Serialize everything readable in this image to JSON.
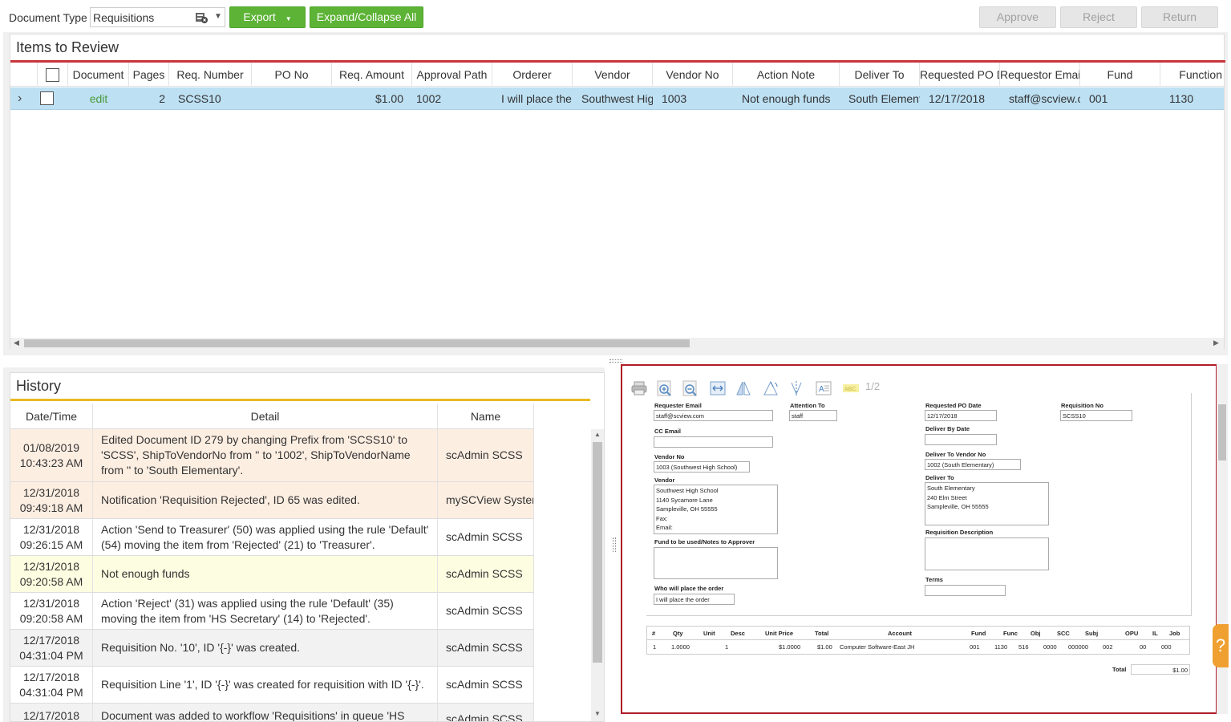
{
  "toolbar": {
    "doc_type_label": "Document Type",
    "doc_type_value": "Requisitions",
    "export_label": "Export",
    "expand_collapse_label": "Expand/Collapse All",
    "approve_label": "Approve",
    "reject_label": "Reject",
    "return_label": "Return"
  },
  "items": {
    "title": "Items to Review",
    "columns": [
      "Document",
      "Pages",
      "Req. Number",
      "PO No",
      "Req. Amount",
      "Approval Path",
      "Orderer",
      "Vendor",
      "Vendor No",
      "Action Note",
      "Deliver To",
      "Requested PO D",
      "Requestor Emai",
      "Fund",
      "Function"
    ],
    "row": {
      "document": "edit",
      "pages": "2",
      "req_number": "SCSS10",
      "po_no": "",
      "req_amount": "$1.00",
      "approval_path": "1002",
      "orderer": "I will place the",
      "vendor": "Southwest Hig",
      "vendor_no": "1003",
      "action_note": "Not enough funds",
      "deliver_to": "South Element",
      "requested_po_date": "12/17/2018",
      "requestor_email": "staff@scview.c",
      "fund": "001",
      "function": "1130"
    }
  },
  "history": {
    "title": "History",
    "columns": [
      "Date/Time",
      "Detail",
      "Name"
    ],
    "rows": [
      {
        "date": "01/08/2019",
        "time": "10:43:23 AM",
        "detail": "Edited Document ID 279 by changing Prefix from 'SCSS10' to 'SCSS', ShipToVendorNo from '' to '1002', ShipToVendorName from '' to 'South Elementary'.",
        "name": "scAdmin SCSS"
      },
      {
        "date": "12/31/2018",
        "time": "09:49:18 AM",
        "detail": "Notification 'Requisition Rejected', ID 65 was edited.",
        "name": "mySCView System"
      },
      {
        "date": "12/31/2018",
        "time": "09:26:15 AM",
        "detail": "Action 'Send to Treasurer' (50) was applied using the rule 'Default' (54) moving the item from 'Rejected' (21) to 'Treasurer'.",
        "name": "scAdmin SCSS"
      },
      {
        "date": "12/31/2018",
        "time": "09:20:58 AM",
        "detail": "Not enough funds",
        "name": "scAdmin SCSS"
      },
      {
        "date": "12/31/2018",
        "time": "09:20:58 AM",
        "detail": "Action 'Reject' (31) was applied using the rule 'Default' (35) moving the item from 'HS Secretary' (14) to 'Rejected'.",
        "name": "scAdmin SCSS"
      },
      {
        "date": "12/17/2018",
        "time": "04:31:04 PM",
        "detail": "Requisition No. '10', ID '{-}' was created.",
        "name": "scAdmin SCSS"
      },
      {
        "date": "12/17/2018",
        "time": "04:31:04 PM",
        "detail": "Requisition Line '1', ID '{-}' was created for requisition with ID '{-}'.",
        "name": "scAdmin SCSS"
      },
      {
        "date": "12/17/2018",
        "time": "",
        "detail": "Document was added to workflow 'Requisitions' in queue 'HS",
        "name": "scAdmin SCSS"
      }
    ]
  },
  "viewer": {
    "page_indicator": "1/2",
    "form": {
      "requester_email_label": "Requester Email",
      "requester_email": "staff@scview.com",
      "attention_to_label": "Attention To",
      "attention_to": "staff",
      "requested_po_date_label": "Requested PO Date",
      "requested_po_date": "12/17/2018",
      "requisition_no_label": "Requisition No",
      "requisition_no": "SCSS10",
      "cc_email_label": "CC Email",
      "deliver_by_date_label": "Deliver By Date",
      "vendor_no_label": "Vendor No",
      "vendor_no": "1003 (Southwest High School)",
      "deliver_to_vendor_no_label": "Deliver To Vendor No",
      "deliver_to_vendor_no": "1002 (South Elementary)",
      "vendor_label": "Vendor",
      "vendor_lines": [
        "Southwest High School",
        "1140 Sycamore Lane",
        "Sampleville, OH 55555",
        "Fax:",
        "Email:"
      ],
      "deliver_to_label": "Deliver To",
      "deliver_to_lines": [
        "South Elementary",
        "240 Elm Street",
        "Sampleville, OH 55555"
      ],
      "requisition_description_label": "Requisition Description",
      "fund_notes_label": "Fund to be used/Notes to Approver",
      "terms_label": "Terms",
      "who_places_label": "Who will place the order",
      "who_places": "I will place the order"
    },
    "line_table": {
      "columns": [
        "#",
        "Qty",
        "Unit",
        "Desc",
        "Unit Price",
        "Total",
        "Account",
        "Fund",
        "Func",
        "Obj",
        "SCC",
        "Subj",
        "OPU",
        "IL",
        "Job"
      ],
      "row": [
        "1",
        "1.0000",
        "",
        "1",
        "$1.0000",
        "$1.00",
        "Computer Software-East JH",
        "001",
        "1130",
        "516",
        "0000",
        "000000",
        "002",
        "00",
        "000"
      ]
    },
    "total_label": "Total",
    "total_value": "$1.00"
  },
  "help_tab": "?",
  "colors": {
    "green": "#5cb335",
    "red_accent": "#c9353b",
    "yellow_accent": "#e9b922",
    "selected_row": "#bde0f3",
    "highlight_orange": "#fdeee2",
    "highlight_yellow": "#fdfde1"
  }
}
